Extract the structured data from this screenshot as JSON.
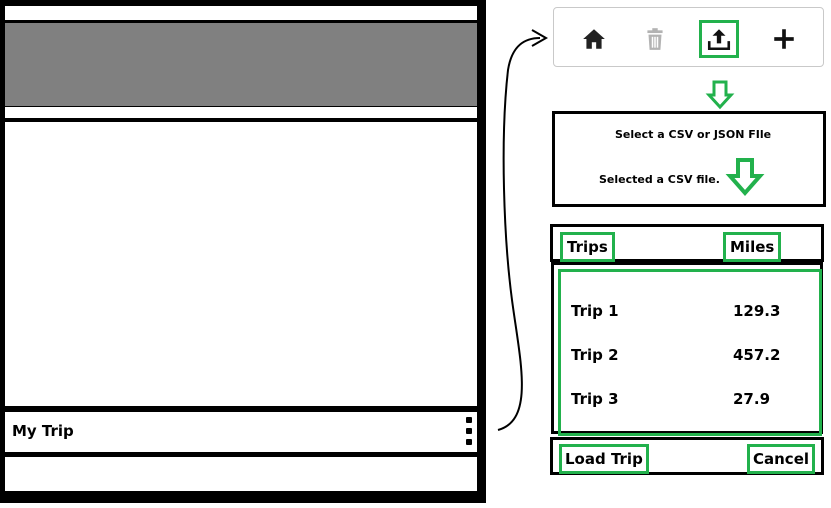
{
  "phone": {
    "trip_label": "My Trip",
    "menu_icon": "kebab-menu-icon"
  },
  "toolbar": {
    "icons": [
      "home-icon",
      "trash-icon",
      "upload-icon",
      "plus-icon"
    ],
    "disabled_color": "#b3b3b3"
  },
  "file_dialog": {
    "prompt": "Select a CSV or JSON FIle",
    "status": "Selected a CSV file."
  },
  "trip_table": {
    "headers": [
      "Trips",
      "Miles"
    ],
    "rows": [
      {
        "name": "Trip 1",
        "miles": "129.3"
      },
      {
        "name": "Trip 2",
        "miles": "457.2"
      },
      {
        "name": "Trip 3",
        "miles": "27.9"
      }
    ]
  },
  "actions": {
    "load_label": "Load Trip",
    "cancel_label": "Cancel"
  },
  "colors": {
    "highlight": "#22b14c",
    "banner": "#808080",
    "frame": "#000000"
  }
}
